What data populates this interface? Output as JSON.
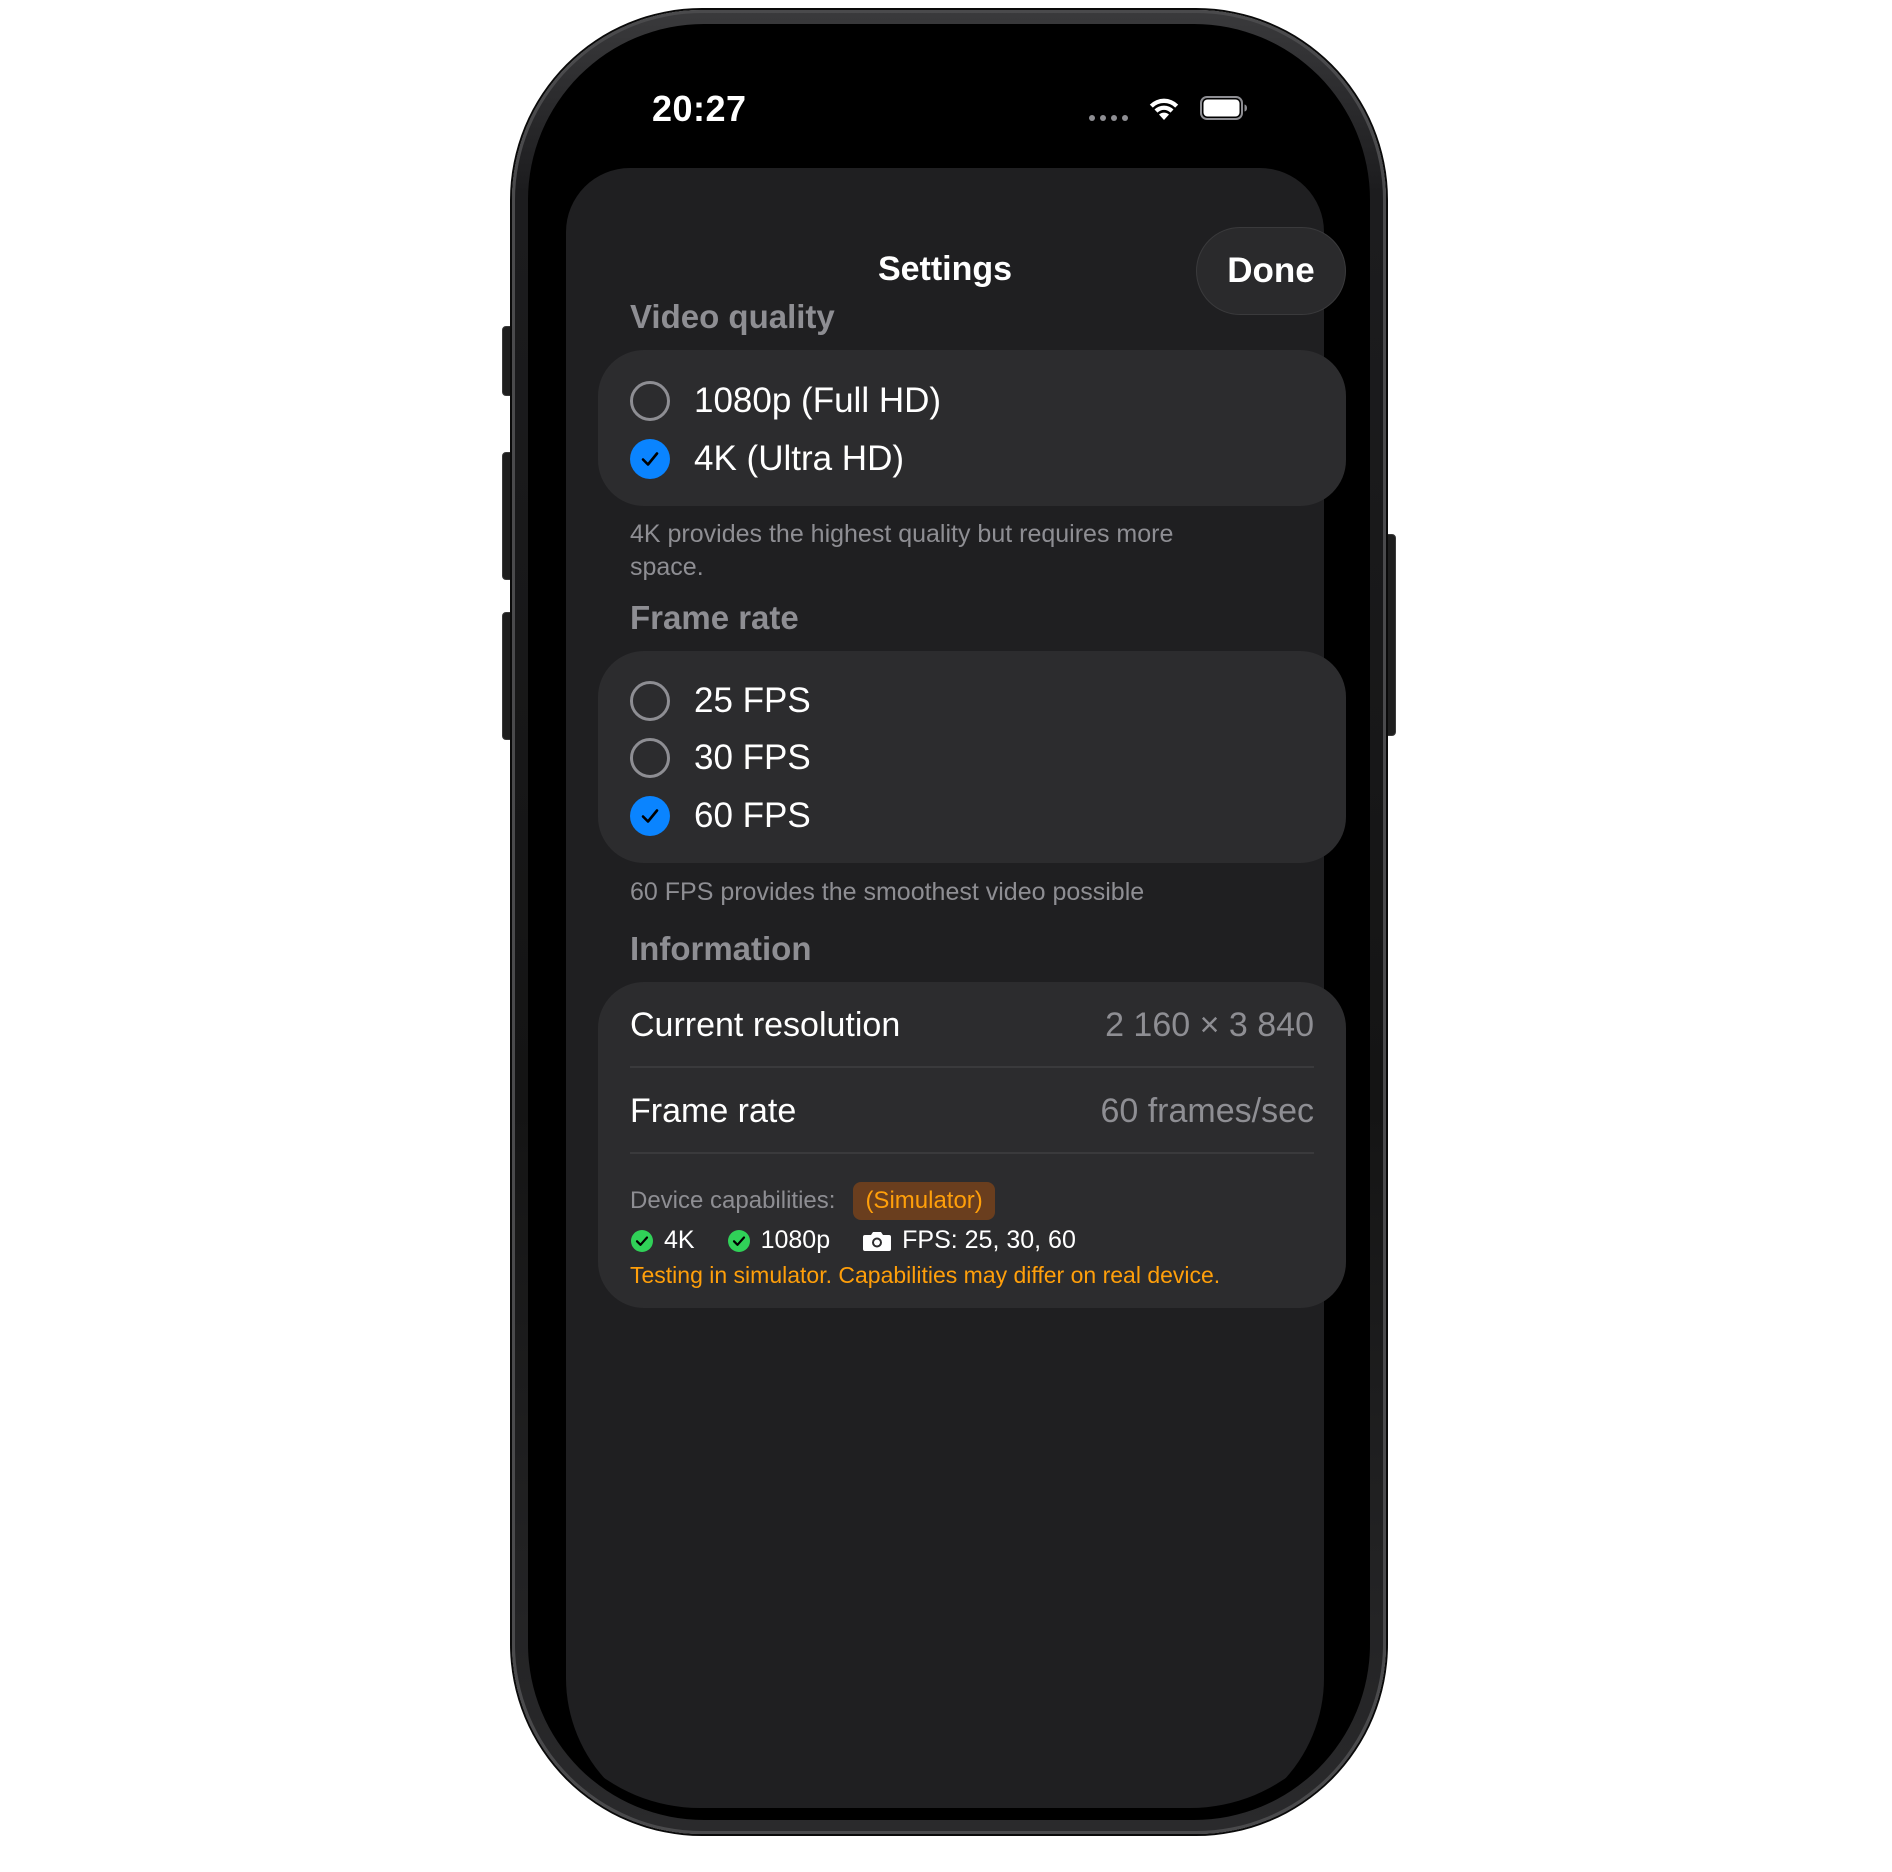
{
  "status_bar": {
    "time": "20:27"
  },
  "sheet": {
    "title": "Settings",
    "done_label": "Done"
  },
  "video_quality": {
    "header": "Video quality",
    "options": [
      {
        "label": "1080p (Full HD)",
        "selected": false
      },
      {
        "label": "4K (Ultra HD)",
        "selected": true
      }
    ],
    "footnote": "4K provides the highest quality but requires more space."
  },
  "frame_rate": {
    "header": "Frame rate",
    "options": [
      {
        "label": "25 FPS",
        "selected": false
      },
      {
        "label": "30 FPS",
        "selected": false
      },
      {
        "label": "60 FPS",
        "selected": true
      }
    ],
    "footnote": "60 FPS provides the smoothest video possible"
  },
  "information": {
    "header": "Information",
    "rows": [
      {
        "label": "Current resolution",
        "value": "2 160 × 3 840"
      },
      {
        "label": "Frame rate",
        "value": "60 frames/sec"
      }
    ],
    "capabilities_label": "Device capabilities:",
    "simulator_badge": "(Simulator)",
    "capabilities": [
      {
        "icon": "green-check-icon",
        "text": "4K"
      },
      {
        "icon": "green-check-icon",
        "text": "1080p"
      },
      {
        "icon": "camera-icon",
        "text": "FPS: 25, 30, 60"
      }
    ],
    "warning": "Testing in simulator. Capabilities may differ on real device."
  },
  "colors": {
    "accent": "#0a84ff",
    "success": "#30d158",
    "warning": "#ff9f0a",
    "sheet_background": "#1f1f21",
    "card_background": "#2c2c2e",
    "secondary_text": "#8e8e93"
  }
}
